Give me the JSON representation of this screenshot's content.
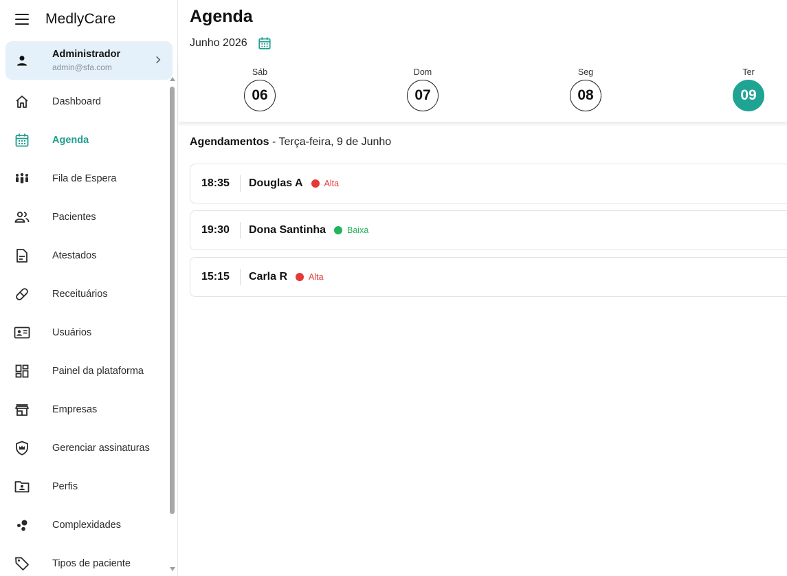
{
  "app": {
    "brand": "MedlyCare"
  },
  "user": {
    "name": "Administrador",
    "email": "admin@sfa.com"
  },
  "sidebar": {
    "items": [
      {
        "label": "Dashboard",
        "icon": "home-icon",
        "active": false
      },
      {
        "label": "Agenda",
        "icon": "calendar-icon",
        "active": true
      },
      {
        "label": "Fila de Espera",
        "icon": "people-queue-icon",
        "active": false
      },
      {
        "label": "Pacientes",
        "icon": "patients-icon",
        "active": false
      },
      {
        "label": "Atestados",
        "icon": "document-icon",
        "active": false
      },
      {
        "label": "Receituários",
        "icon": "pill-icon",
        "active": false
      },
      {
        "label": "Usuários",
        "icon": "id-card-icon",
        "active": false
      },
      {
        "label": "Painel da plataforma",
        "icon": "dashboard-grid-icon",
        "active": false
      },
      {
        "label": "Empresas",
        "icon": "store-icon",
        "active": false
      },
      {
        "label": "Gerenciar assinaturas",
        "icon": "shield-crown-icon",
        "active": false
      },
      {
        "label": "Perfis",
        "icon": "profile-folder-icon",
        "active": false
      },
      {
        "label": "Complexidades",
        "icon": "bubbles-icon",
        "active": false
      },
      {
        "label": "Tipos de paciente",
        "icon": "tag-icon",
        "active": false
      }
    ]
  },
  "main": {
    "title": "Agenda",
    "month": "Junho 2026",
    "days": [
      {
        "name": "Sáb",
        "num": "06",
        "selected": false
      },
      {
        "name": "Dom",
        "num": "07",
        "selected": false
      },
      {
        "name": "Seg",
        "num": "08",
        "selected": false
      },
      {
        "name": "Ter",
        "num": "09",
        "selected": true
      }
    ],
    "appointments_heading": {
      "bold": "Agendamentos",
      "rest": " - Terça-feira, 9 de Junho"
    },
    "appointments": [
      {
        "time": "18:35",
        "name": "Douglas A",
        "priority": "Alta"
      },
      {
        "time": "19:30",
        "name": "Dona Santinha",
        "priority": "Baixa"
      },
      {
        "time": "15:15",
        "name": "Carla R",
        "priority": "Alta"
      }
    ]
  },
  "colors": {
    "accent": "#1fa393",
    "high": "#e53935",
    "low": "#22b45a",
    "user_card_bg": "#e4f0fa"
  }
}
